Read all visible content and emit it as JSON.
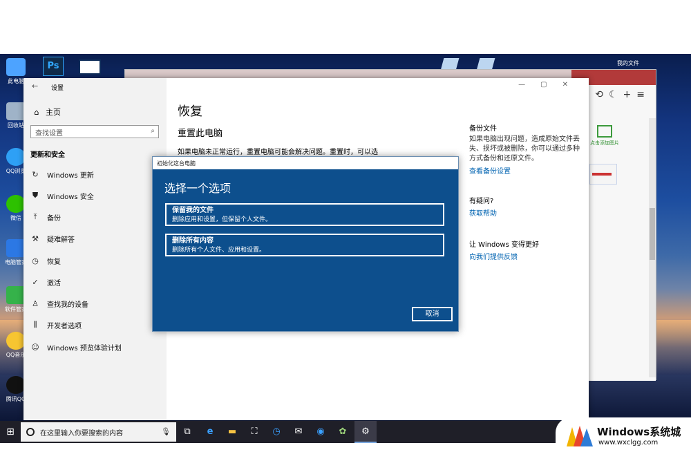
{
  "desktop": {
    "icons": [
      {
        "label": "此电脑",
        "color": "#4da3ff"
      },
      {
        "label": "回收站",
        "color": "#9fb3c8"
      },
      {
        "label": "QQ浏览",
        "color": "#2ea0f5"
      },
      {
        "label": "微信",
        "color": "#2dc100"
      },
      {
        "label": "电脑管家",
        "color": "#2c78e4"
      },
      {
        "label": "软件管家",
        "color": "#35b24a"
      },
      {
        "label": "QQ音乐",
        "color": "#f7c531"
      },
      {
        "label": "腾讯QQ",
        "color": "#111111"
      }
    ],
    "top_icons": [
      {
        "label": "Ps",
        "color": "#0f2b4a"
      }
    ]
  },
  "background_window": {
    "my_docs_label": "我的文件",
    "add_image_label": "点击添加图片"
  },
  "settings": {
    "app_title": "设置",
    "home_label": "主页",
    "search_placeholder": "查找设置",
    "section_title": "更新和安全",
    "nav_items": [
      {
        "label": "Windows 更新",
        "icon": "refresh-icon"
      },
      {
        "label": "Windows 安全",
        "icon": "shield-icon"
      },
      {
        "label": "备份",
        "icon": "backup-icon"
      },
      {
        "label": "疑难解答",
        "icon": "wrench-icon"
      },
      {
        "label": "恢复",
        "icon": "history-icon"
      },
      {
        "label": "激活",
        "icon": "check-circle-icon"
      },
      {
        "label": "查找我的设备",
        "icon": "person-pin-icon"
      },
      {
        "label": "开发者选项",
        "icon": "developer-icon"
      },
      {
        "label": "Windows 预览体验计划",
        "icon": "insider-icon"
      }
    ],
    "page_title": "恢复",
    "reset_heading": "重置此电脑",
    "reset_text": "如果电脑未正常运行，重置电脑可能会解决问题。重置时，可以选",
    "related": {
      "backup_heading": "备份文件",
      "backup_text": "如果电脑出现问题，造成原始文件丢失、损坏或被删除，你可以通过多种方式备份和还原文件。",
      "backup_link": "查看备份设置",
      "question_heading": "有疑问?",
      "question_link": "获取帮助",
      "improve_heading": "让 Windows 变得更好",
      "improve_link": "向我们提供反馈"
    }
  },
  "dialog": {
    "title": "初始化这台电脑",
    "heading": "选择一个选项",
    "options": [
      {
        "title": "保留我的文件",
        "desc": "删除应用和设置，但保留个人文件。"
      },
      {
        "title": "删除所有内容",
        "desc": "删除所有个人文件、应用和设置。"
      }
    ],
    "cancel_label": "取消"
  },
  "taskbar": {
    "search_placeholder": "在这里输入你要搜索的内容",
    "apps": [
      "task-view-icon",
      "edge-icon",
      "file-explorer-icon",
      "store-icon",
      "clock-icon",
      "mail-icon",
      "qq-browser-icon",
      "photo-icon",
      "settings-gear-icon"
    ]
  },
  "watermark": {
    "brand": "Windows系统城",
    "url": "www.wxclgg.com"
  }
}
